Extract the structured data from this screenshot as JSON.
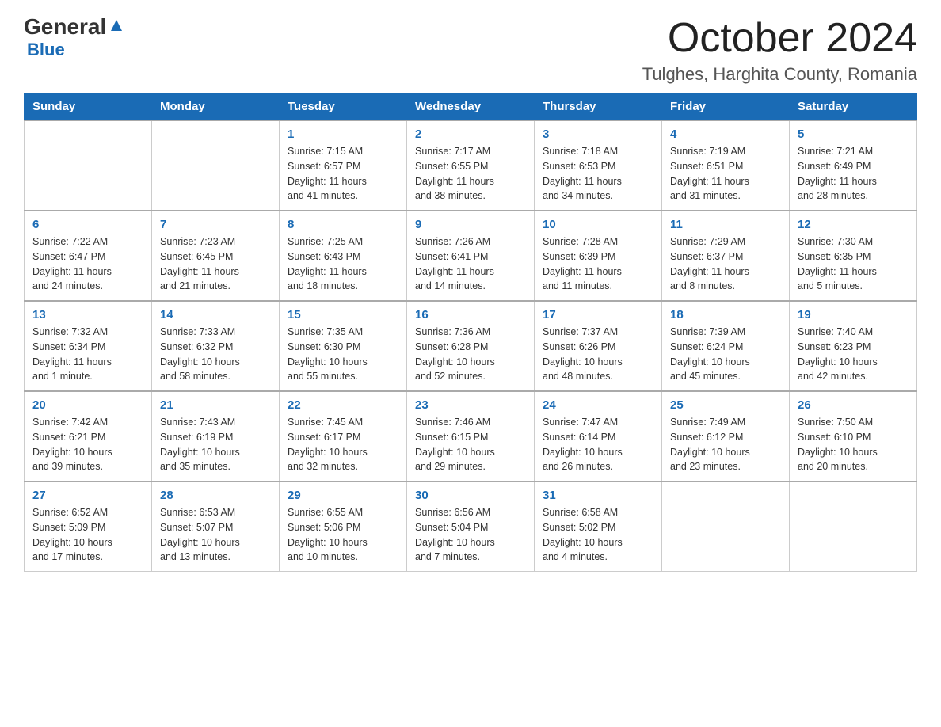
{
  "header": {
    "logo_general": "General",
    "logo_blue": "Blue",
    "month_title": "October 2024",
    "location": "Tulghes, Harghita County, Romania"
  },
  "days_of_week": [
    "Sunday",
    "Monday",
    "Tuesday",
    "Wednesday",
    "Thursday",
    "Friday",
    "Saturday"
  ],
  "weeks": [
    [
      {
        "day": "",
        "info": ""
      },
      {
        "day": "",
        "info": ""
      },
      {
        "day": "1",
        "info": "Sunrise: 7:15 AM\nSunset: 6:57 PM\nDaylight: 11 hours\nand 41 minutes."
      },
      {
        "day": "2",
        "info": "Sunrise: 7:17 AM\nSunset: 6:55 PM\nDaylight: 11 hours\nand 38 minutes."
      },
      {
        "day": "3",
        "info": "Sunrise: 7:18 AM\nSunset: 6:53 PM\nDaylight: 11 hours\nand 34 minutes."
      },
      {
        "day": "4",
        "info": "Sunrise: 7:19 AM\nSunset: 6:51 PM\nDaylight: 11 hours\nand 31 minutes."
      },
      {
        "day": "5",
        "info": "Sunrise: 7:21 AM\nSunset: 6:49 PM\nDaylight: 11 hours\nand 28 minutes."
      }
    ],
    [
      {
        "day": "6",
        "info": "Sunrise: 7:22 AM\nSunset: 6:47 PM\nDaylight: 11 hours\nand 24 minutes."
      },
      {
        "day": "7",
        "info": "Sunrise: 7:23 AM\nSunset: 6:45 PM\nDaylight: 11 hours\nand 21 minutes."
      },
      {
        "day": "8",
        "info": "Sunrise: 7:25 AM\nSunset: 6:43 PM\nDaylight: 11 hours\nand 18 minutes."
      },
      {
        "day": "9",
        "info": "Sunrise: 7:26 AM\nSunset: 6:41 PM\nDaylight: 11 hours\nand 14 minutes."
      },
      {
        "day": "10",
        "info": "Sunrise: 7:28 AM\nSunset: 6:39 PM\nDaylight: 11 hours\nand 11 minutes."
      },
      {
        "day": "11",
        "info": "Sunrise: 7:29 AM\nSunset: 6:37 PM\nDaylight: 11 hours\nand 8 minutes."
      },
      {
        "day": "12",
        "info": "Sunrise: 7:30 AM\nSunset: 6:35 PM\nDaylight: 11 hours\nand 5 minutes."
      }
    ],
    [
      {
        "day": "13",
        "info": "Sunrise: 7:32 AM\nSunset: 6:34 PM\nDaylight: 11 hours\nand 1 minute."
      },
      {
        "day": "14",
        "info": "Sunrise: 7:33 AM\nSunset: 6:32 PM\nDaylight: 10 hours\nand 58 minutes."
      },
      {
        "day": "15",
        "info": "Sunrise: 7:35 AM\nSunset: 6:30 PM\nDaylight: 10 hours\nand 55 minutes."
      },
      {
        "day": "16",
        "info": "Sunrise: 7:36 AM\nSunset: 6:28 PM\nDaylight: 10 hours\nand 52 minutes."
      },
      {
        "day": "17",
        "info": "Sunrise: 7:37 AM\nSunset: 6:26 PM\nDaylight: 10 hours\nand 48 minutes."
      },
      {
        "day": "18",
        "info": "Sunrise: 7:39 AM\nSunset: 6:24 PM\nDaylight: 10 hours\nand 45 minutes."
      },
      {
        "day": "19",
        "info": "Sunrise: 7:40 AM\nSunset: 6:23 PM\nDaylight: 10 hours\nand 42 minutes."
      }
    ],
    [
      {
        "day": "20",
        "info": "Sunrise: 7:42 AM\nSunset: 6:21 PM\nDaylight: 10 hours\nand 39 minutes."
      },
      {
        "day": "21",
        "info": "Sunrise: 7:43 AM\nSunset: 6:19 PM\nDaylight: 10 hours\nand 35 minutes."
      },
      {
        "day": "22",
        "info": "Sunrise: 7:45 AM\nSunset: 6:17 PM\nDaylight: 10 hours\nand 32 minutes."
      },
      {
        "day": "23",
        "info": "Sunrise: 7:46 AM\nSunset: 6:15 PM\nDaylight: 10 hours\nand 29 minutes."
      },
      {
        "day": "24",
        "info": "Sunrise: 7:47 AM\nSunset: 6:14 PM\nDaylight: 10 hours\nand 26 minutes."
      },
      {
        "day": "25",
        "info": "Sunrise: 7:49 AM\nSunset: 6:12 PM\nDaylight: 10 hours\nand 23 minutes."
      },
      {
        "day": "26",
        "info": "Sunrise: 7:50 AM\nSunset: 6:10 PM\nDaylight: 10 hours\nand 20 minutes."
      }
    ],
    [
      {
        "day": "27",
        "info": "Sunrise: 6:52 AM\nSunset: 5:09 PM\nDaylight: 10 hours\nand 17 minutes."
      },
      {
        "day": "28",
        "info": "Sunrise: 6:53 AM\nSunset: 5:07 PM\nDaylight: 10 hours\nand 13 minutes."
      },
      {
        "day": "29",
        "info": "Sunrise: 6:55 AM\nSunset: 5:06 PM\nDaylight: 10 hours\nand 10 minutes."
      },
      {
        "day": "30",
        "info": "Sunrise: 6:56 AM\nSunset: 5:04 PM\nDaylight: 10 hours\nand 7 minutes."
      },
      {
        "day": "31",
        "info": "Sunrise: 6:58 AM\nSunset: 5:02 PM\nDaylight: 10 hours\nand 4 minutes."
      },
      {
        "day": "",
        "info": ""
      },
      {
        "day": "",
        "info": ""
      }
    ]
  ]
}
